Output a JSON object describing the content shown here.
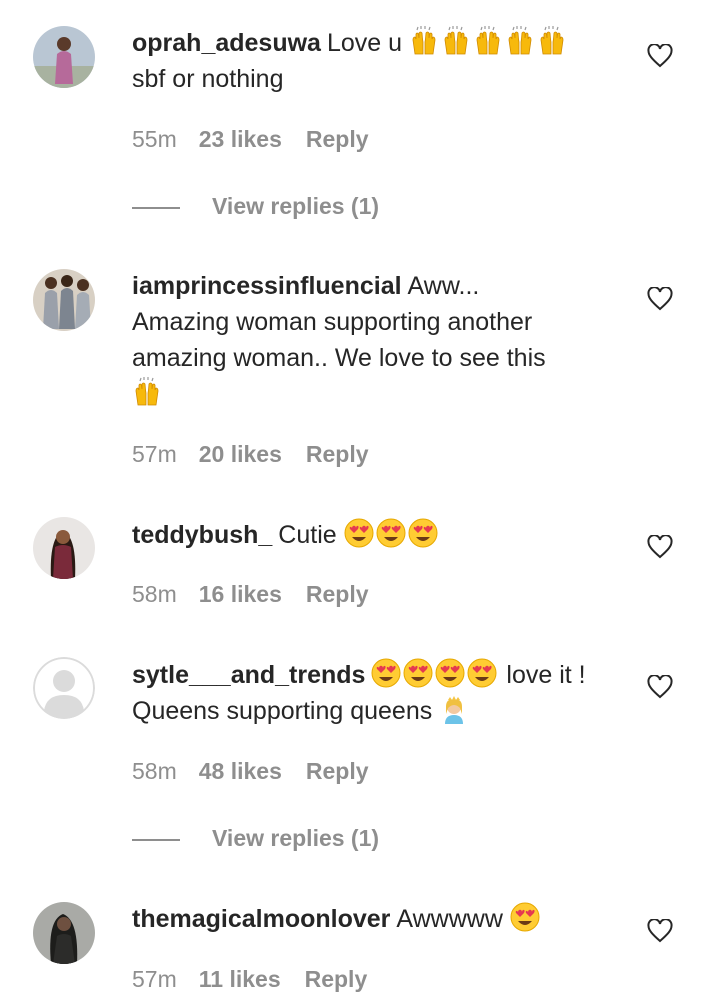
{
  "colors": {
    "text": "#262626",
    "muted": "#8e8e8e",
    "background": "#ffffff"
  },
  "comments": [
    {
      "username": "oprah_adesuwa",
      "text_before": "Love u",
      "emojis": [
        "raising-hands-emoji",
        "raising-hands-emoji",
        "raising-hands-emoji",
        "raising-hands-emoji",
        "raising-hands-emoji"
      ],
      "text_line2": "sbf or nothing",
      "time": "55m",
      "likes": "23 likes",
      "reply": "Reply",
      "view_replies": "View replies (1)"
    },
    {
      "username": "iamprincessinfluencial",
      "text_before": "Aww...",
      "text_line2": "Amazing woman supporting another",
      "text_line3": "amazing woman.. We love to see this",
      "emojis": [
        "raising-hands-emoji"
      ],
      "time": "57m",
      "likes": "20 likes",
      "reply": "Reply"
    },
    {
      "username": "teddybush_",
      "text_before": "Cutie",
      "emojis": [
        "heart-eyes-emoji",
        "heart-eyes-emoji",
        "heart-eyes-emoji"
      ],
      "time": "58m",
      "likes": "16 likes",
      "reply": "Reply"
    },
    {
      "username": "sytle___and_trends",
      "emojis": [
        "heart-eyes-emoji",
        "heart-eyes-emoji",
        "heart-eyes-emoji",
        "heart-eyes-emoji"
      ],
      "text_after": "love it !",
      "text_line2": "Queens supporting queens",
      "emojis_line2": [
        "princess-emoji"
      ],
      "time": "58m",
      "likes": "48 likes",
      "reply": "Reply",
      "view_replies": "View replies (1)"
    },
    {
      "username": "themagicalmoonlover",
      "text_before": "Awwwww",
      "emojis": [
        "heart-eyes-emoji"
      ],
      "time": "57m",
      "likes": "11 likes",
      "reply": "Reply"
    }
  ]
}
